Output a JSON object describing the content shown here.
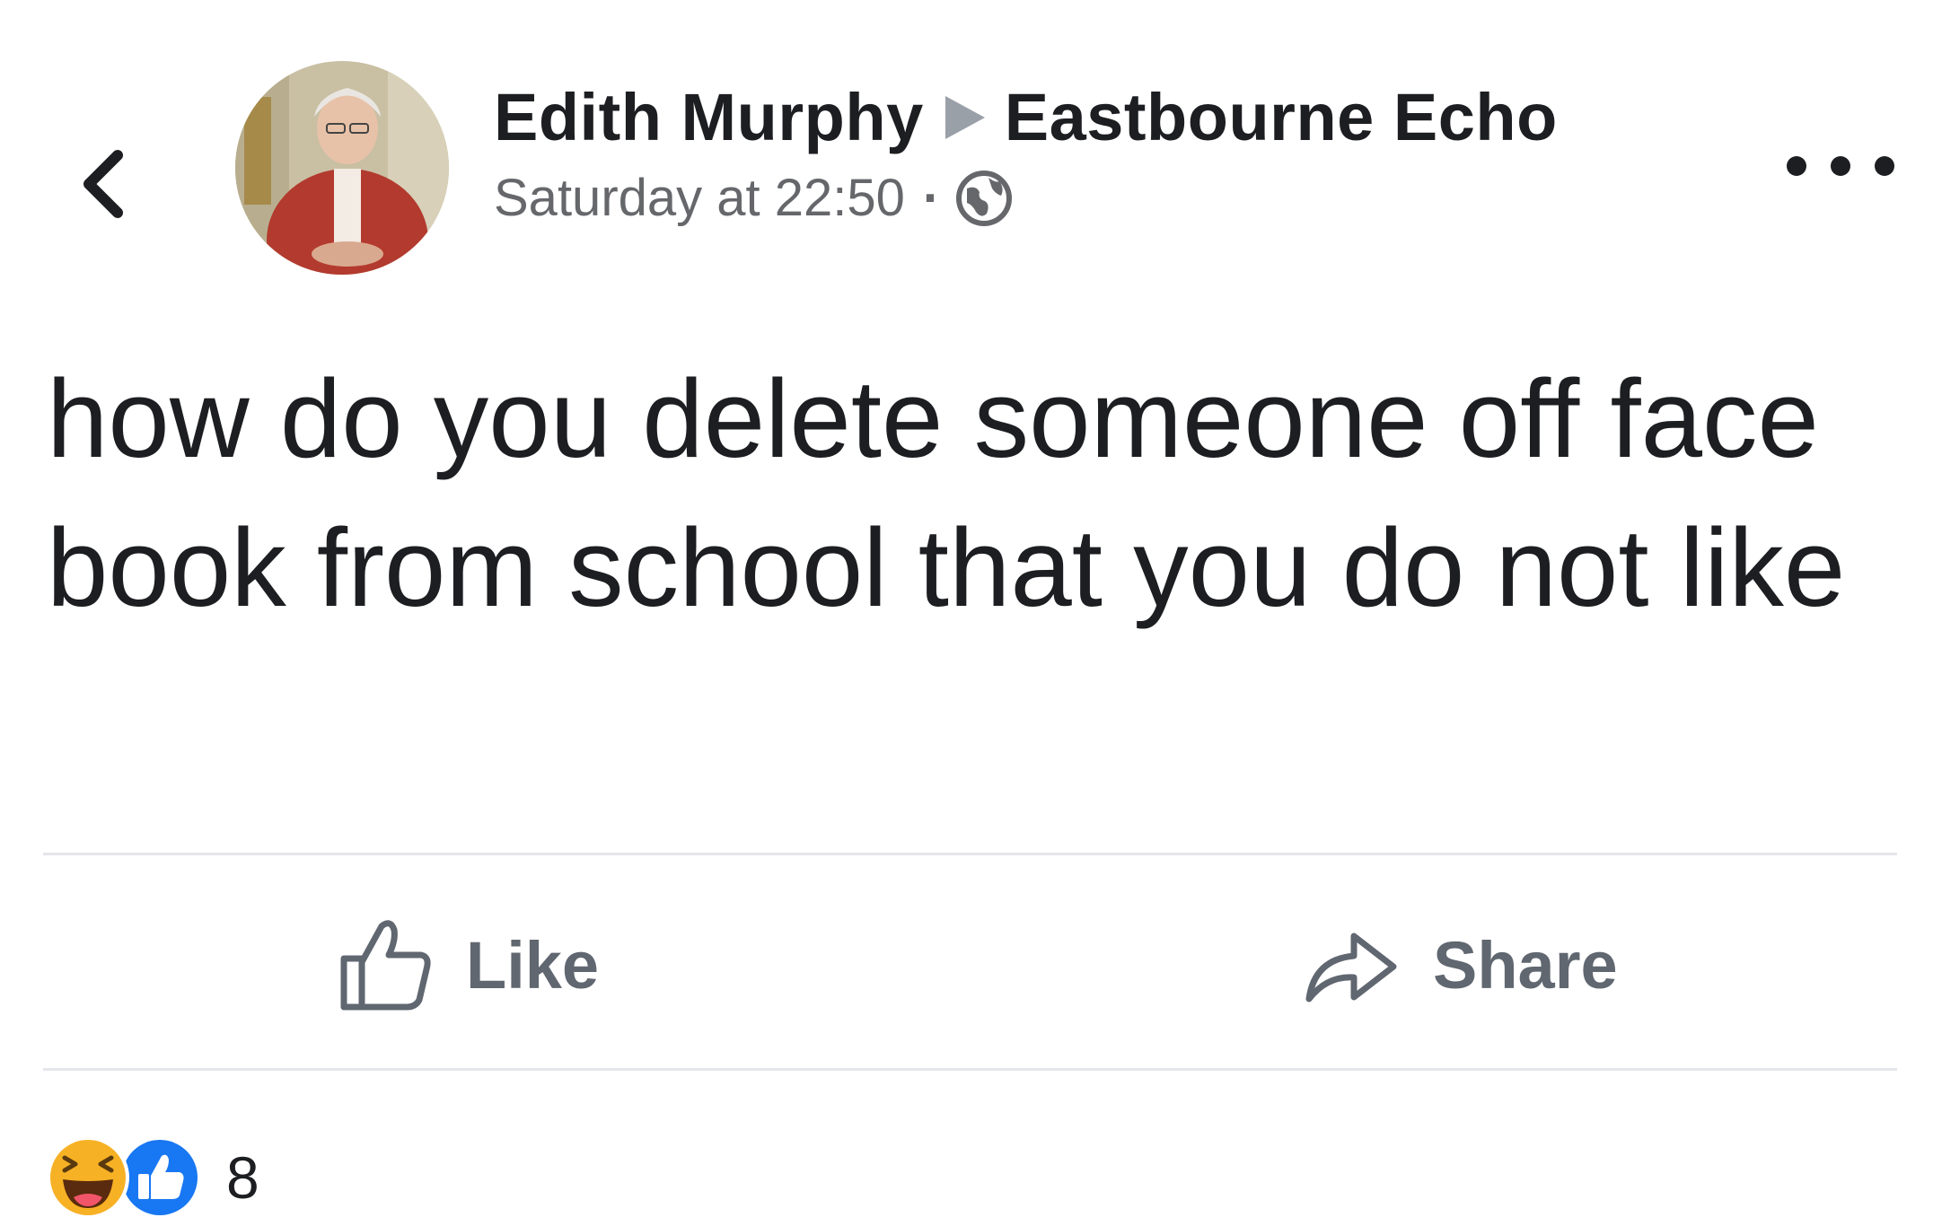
{
  "header": {
    "back_icon": "chevron-left-icon",
    "author_name": "Edith Murphy",
    "arrow_icon": "triangle-right-icon",
    "group_name": "Eastbourne Echo",
    "timestamp": "Saturday at 22:50",
    "separator": "·",
    "privacy_icon": "globe-icon",
    "more_icon": "ellipsis-icon"
  },
  "post": {
    "text": "how do you delete someone off face book from school that you do not like"
  },
  "actions": {
    "like_label": "Like",
    "share_label": "Share"
  },
  "reactions": {
    "icons": [
      "haha-reaction-icon",
      "like-reaction-icon"
    ],
    "count": "8"
  },
  "colors": {
    "text_primary": "#1c1e21",
    "text_secondary": "#65676b",
    "action_text": "#606770",
    "divider": "#e4e6eb",
    "like_blue": "#1877f2",
    "haha_yellow": "#f7b125"
  }
}
